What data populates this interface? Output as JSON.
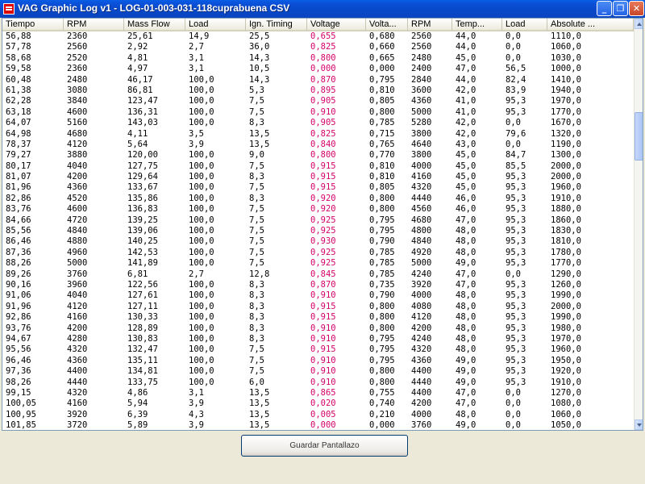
{
  "window": {
    "title": "VAG Graphic Log  v1 -  LOG-01-003-031-118cuprabuena CSV",
    "buttons": {
      "minimize": "_",
      "maximize": "❐",
      "close": "✕"
    }
  },
  "columns": [
    "Tiempo",
    "RPM",
    "Mass Flow",
    "Load",
    "Ign. Timing",
    "Voltage",
    "Volta...",
    "RPM",
    "Temp...",
    "Load",
    "Absolute ..."
  ],
  "colors": {
    "voltage_text": "#d4006a",
    "titlebar": "#0a50d8"
  },
  "rows": [
    [
      "56,88",
      "2360",
      "25,61",
      "14,9",
      "25,5",
      "0,655",
      "0,680",
      "2560",
      "44,0",
      "0,0",
      "1110,0"
    ],
    [
      "57,78",
      "2560",
      "2,92",
      "2,7",
      "36,0",
      "0,825",
      "0,660",
      "2560",
      "44,0",
      "0,0",
      "1060,0"
    ],
    [
      "58,68",
      "2520",
      "4,81",
      "3,1",
      "14,3",
      "0,800",
      "0,665",
      "2480",
      "45,0",
      "0,0",
      "1030,0"
    ],
    [
      "59,58",
      "2360",
      "4,97",
      "3,1",
      "10,5",
      "0,000",
      "0,000",
      "2400",
      "47,0",
      "56,5",
      "1000,0"
    ],
    [
      "60,48",
      "2480",
      "46,17",
      "100,0",
      "14,3",
      "0,870",
      "0,795",
      "2840",
      "44,0",
      "82,4",
      "1410,0"
    ],
    [
      "61,38",
      "3080",
      "86,81",
      "100,0",
      "5,3",
      "0,895",
      "0,810",
      "3600",
      "42,0",
      "83,9",
      "1940,0"
    ],
    [
      "62,28",
      "3840",
      "123,47",
      "100,0",
      "7,5",
      "0,905",
      "0,805",
      "4360",
      "41,0",
      "95,3",
      "1970,0"
    ],
    [
      "63,18",
      "4600",
      "136,31",
      "100,0",
      "7,5",
      "0,910",
      "0,800",
      "5000",
      "41,0",
      "95,3",
      "1770,0"
    ],
    [
      "64,07",
      "5160",
      "143,03",
      "100,0",
      "8,3",
      "0,905",
      "0,785",
      "5280",
      "42,0",
      "0,0",
      "1670,0"
    ],
    [
      "64,98",
      "4680",
      "4,11",
      "3,5",
      "13,5",
      "0,825",
      "0,715",
      "3800",
      "42,0",
      "79,6",
      "1320,0"
    ],
    [
      "78,37",
      "4120",
      "5,64",
      "3,9",
      "13,5",
      "0,840",
      "0,765",
      "4640",
      "43,0",
      "0,0",
      "1190,0"
    ],
    [
      "79,27",
      "3880",
      "120,00",
      "100,0",
      "9,0",
      "0,800",
      "0,770",
      "3800",
      "45,0",
      "84,7",
      "1300,0"
    ],
    [
      "80,17",
      "4040",
      "127,75",
      "100,0",
      "7,5",
      "0,915",
      "0,810",
      "4000",
      "45,0",
      "85,5",
      "2000,0"
    ],
    [
      "81,07",
      "4200",
      "129,64",
      "100,0",
      "8,3",
      "0,915",
      "0,810",
      "4160",
      "45,0",
      "95,3",
      "2000,0"
    ],
    [
      "81,96",
      "4360",
      "133,67",
      "100,0",
      "7,5",
      "0,915",
      "0,805",
      "4320",
      "45,0",
      "95,3",
      "1960,0"
    ],
    [
      "82,86",
      "4520",
      "135,86",
      "100,0",
      "8,3",
      "0,920",
      "0,800",
      "4440",
      "46,0",
      "95,3",
      "1910,0"
    ],
    [
      "83,76",
      "4600",
      "136,83",
      "100,0",
      "7,5",
      "0,920",
      "0,800",
      "4560",
      "46,0",
      "95,3",
      "1880,0"
    ],
    [
      "84,66",
      "4720",
      "139,25",
      "100,0",
      "7,5",
      "0,925",
      "0,795",
      "4680",
      "47,0",
      "95,3",
      "1860,0"
    ],
    [
      "85,56",
      "4840",
      "139,06",
      "100,0",
      "7,5",
      "0,925",
      "0,795",
      "4800",
      "48,0",
      "95,3",
      "1830,0"
    ],
    [
      "86,46",
      "4880",
      "140,25",
      "100,0",
      "7,5",
      "0,930",
      "0,790",
      "4840",
      "48,0",
      "95,3",
      "1810,0"
    ],
    [
      "87,36",
      "4960",
      "142,53",
      "100,0",
      "7,5",
      "0,925",
      "0,785",
      "4920",
      "48,0",
      "95,3",
      "1780,0"
    ],
    [
      "88,26",
      "5000",
      "141,89",
      "100,0",
      "7,5",
      "0,925",
      "0,785",
      "5000",
      "49,0",
      "95,3",
      "1770,0"
    ],
    [
      "89,26",
      "3760",
      "6,81",
      "2,7",
      "12,8",
      "0,845",
      "0,785",
      "4240",
      "47,0",
      "0,0",
      "1290,0"
    ],
    [
      "90,16",
      "3960",
      "122,56",
      "100,0",
      "8,3",
      "0,870",
      "0,735",
      "3920",
      "47,0",
      "95,3",
      "1260,0"
    ],
    [
      "91,06",
      "4040",
      "127,61",
      "100,0",
      "8,3",
      "0,910",
      "0,790",
      "4000",
      "48,0",
      "95,3",
      "1990,0"
    ],
    [
      "91,96",
      "4120",
      "127,11",
      "100,0",
      "8,3",
      "0,915",
      "0,800",
      "4080",
      "48,0",
      "95,3",
      "2000,0"
    ],
    [
      "92,86",
      "4160",
      "130,33",
      "100,0",
      "8,3",
      "0,915",
      "0,800",
      "4120",
      "48,0",
      "95,3",
      "1990,0"
    ],
    [
      "93,76",
      "4200",
      "128,89",
      "100,0",
      "8,3",
      "0,910",
      "0,800",
      "4200",
      "48,0",
      "95,3",
      "1980,0"
    ],
    [
      "94,67",
      "4280",
      "130,83",
      "100,0",
      "8,3",
      "0,910",
      "0,795",
      "4240",
      "48,0",
      "95,3",
      "1970,0"
    ],
    [
      "95,56",
      "4320",
      "132,47",
      "100,0",
      "7,5",
      "0,915",
      "0,795",
      "4320",
      "48,0",
      "95,3",
      "1960,0"
    ],
    [
      "96,46",
      "4360",
      "135,11",
      "100,0",
      "7,5",
      "0,910",
      "0,795",
      "4360",
      "49,0",
      "95,3",
      "1950,0"
    ],
    [
      "97,36",
      "4400",
      "134,81",
      "100,0",
      "7,5",
      "0,910",
      "0,800",
      "4400",
      "49,0",
      "95,3",
      "1920,0"
    ],
    [
      "98,26",
      "4440",
      "133,75",
      "100,0",
      "6,0",
      "0,910",
      "0,800",
      "4440",
      "49,0",
      "95,3",
      "1910,0"
    ],
    [
      "99,15",
      "4320",
      "4,86",
      "3,1",
      "13,5",
      "0,865",
      "0,755",
      "4400",
      "47,0",
      "0,0",
      "1270,0"
    ],
    [
      "100,05",
      "4160",
      "5,94",
      "3,9",
      "13,5",
      "0,020",
      "0,740",
      "4200",
      "47,0",
      "0,0",
      "1080,0"
    ],
    [
      "100,95",
      "3920",
      "6,39",
      "4,3",
      "13,5",
      "0,005",
      "0,210",
      "4000",
      "48,0",
      "0,0",
      "1060,0"
    ],
    [
      "101,85",
      "3720",
      "5,89",
      "3,9",
      "13,5",
      "0,000",
      "0,000",
      "3760",
      "49,0",
      "0,0",
      "1050,0"
    ]
  ],
  "footer": {
    "save_button": "Guardar Pantallazo"
  }
}
